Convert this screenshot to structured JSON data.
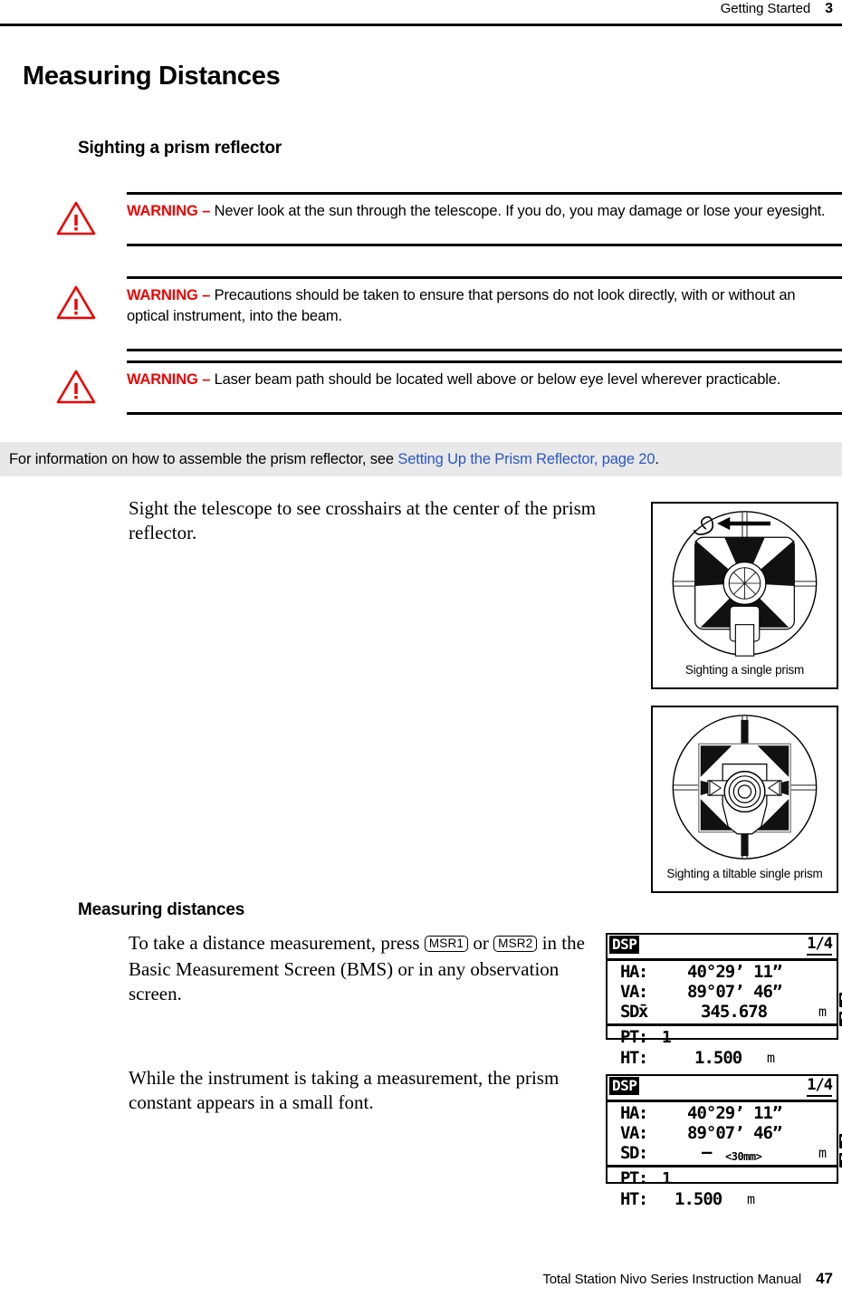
{
  "header": {
    "chapter": "Getting Started",
    "chapter_number": "3"
  },
  "title": "Measuring Distances",
  "sections": {
    "sighting_heading": "Sighting a prism reflector",
    "measuring_heading": "Measuring distances"
  },
  "warnings": [
    {
      "label": "WARNING –",
      "text": " Never look at the sun through the telescope. If you do, you may damage or lose your eyesight.",
      "icon": "warning-triangle-icon",
      "color": "#ee0000"
    },
    {
      "label": "WARNING –",
      "text": " Precautions should be taken to ensure that persons do not look directly, with or without an optical instrument, into the beam.",
      "icon": "warning-triangle-icon",
      "color": "#ee0000"
    },
    {
      "label": "WARNING –",
      "text": " Laser beam path should be located well above or below eye level wherever practicable.",
      "icon": "warning-triangle-icon",
      "color": "#ee0000"
    }
  ],
  "note": {
    "text_before": "For information on how to assemble the prism reflector, see ",
    "link_text": "Setting Up the Prism Reflector, page 20",
    "text_after": ".",
    "background": "#e8e8e8",
    "link_color": "#2a56c6"
  },
  "paragraphs": {
    "sight": "Sight the telescope to see crosshairs at the center of the prism reflector.",
    "msr_before": "To take a distance measurement, press ",
    "msr_key1": "MSR1",
    "msr_mid": " or ",
    "msr_key2": "MSR2",
    "msr_after": " in the Basic Measurement Screen (BMS) or in any observation screen.",
    "prism_constant": "While the instrument is taking a measurement, the prism constant appears in a small font."
  },
  "figures": [
    {
      "caption": "Sighting a single prism",
      "name": "single-prism-sighting-figure"
    },
    {
      "caption": "Sighting a tiltable single prism",
      "name": "tiltable-prism-sighting-figure"
    }
  ],
  "lcd_screens": [
    {
      "name": "bms-measured-screen",
      "tag": "DSP",
      "page": "1/4",
      "rows": [
        {
          "label": "HA:",
          "value": "40°29’ 11”",
          "unit": ""
        },
        {
          "label": "VA:",
          "value": "89°07’ 46”",
          "unit": ""
        },
        {
          "label": "SDx̄",
          "value": "345.678",
          "unit": "m"
        }
      ],
      "bottom": [
        {
          "label": "PT:",
          "value": "1",
          "unit": ""
        },
        {
          "label": "HT:",
          "value": "1.500",
          "unit": "m"
        }
      ],
      "icons": [
        "battery-icon",
        "battery-icon"
      ]
    },
    {
      "name": "bms-measuring-screen",
      "tag": "DSP",
      "page": "1/4",
      "rows": [
        {
          "label": "HA:",
          "value": "40°29’ 11”",
          "unit": ""
        },
        {
          "label": "VA:",
          "value": "89°07’ 46”",
          "unit": ""
        },
        {
          "label": "SD:",
          "value": "–",
          "small": "<30mm>",
          "unit": "m"
        }
      ],
      "bottom": [
        {
          "label": "PT:",
          "value": "1",
          "unit": ""
        },
        {
          "label": "HT:",
          "value": "1.500",
          "unit": "m"
        }
      ],
      "icons": [
        "battery-icon",
        "battery-icon"
      ]
    }
  ],
  "footer": {
    "title": "Total Station Nivo Series Instruction Manual",
    "page_number": "47"
  }
}
